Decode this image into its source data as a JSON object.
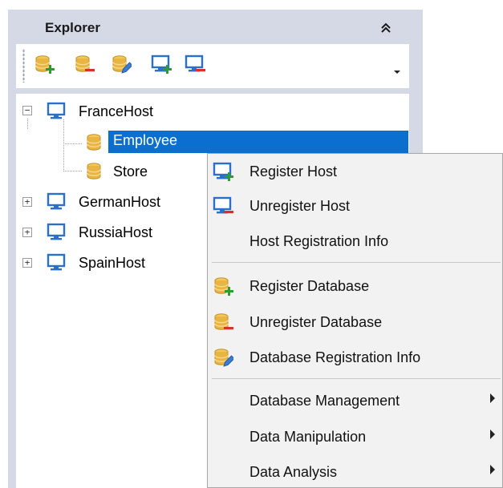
{
  "explorer": {
    "title": "Explorer",
    "collapse_glyph": "»",
    "toolbar": {
      "icons": [
        "register-database-icon",
        "unregister-database-icon",
        "database-info-icon",
        "register-host-icon",
        "unregister-host-icon"
      ],
      "dropdown_glyph": "▾"
    }
  },
  "tree": {
    "hosts": [
      {
        "label": "FranceHost",
        "expanded": true,
        "expander": "−",
        "children": [
          {
            "label": "Employee",
            "selected": true
          },
          {
            "label": "Store",
            "selected": false
          }
        ]
      },
      {
        "label": "GermanHost",
        "expanded": false,
        "expander": "+"
      },
      {
        "label": "RussiaHost",
        "expanded": false,
        "expander": "+"
      },
      {
        "label": "SpainHost",
        "expanded": false,
        "expander": "+"
      }
    ]
  },
  "context_menu": {
    "items": [
      {
        "label": "Register Host",
        "icon": "register-host-icon"
      },
      {
        "label": "Unregister Host",
        "icon": "unregister-host-icon"
      },
      {
        "label": "Host Registration Info",
        "icon": ""
      },
      {
        "label": "Register Database",
        "icon": "register-database-icon"
      },
      {
        "label": "Unregister Database",
        "icon": "unregister-database-icon"
      },
      {
        "label": "Database Registration Info",
        "icon": "database-info-icon"
      },
      {
        "label": "Database Management",
        "submenu": true
      },
      {
        "label": "Data Manipulation",
        "submenu": true
      },
      {
        "label": "Data Analysis",
        "submenu": true
      }
    ]
  },
  "colors": {
    "panel_bg": "#d5d9e6",
    "selection": "#0b6fcf",
    "db_gold": "#e8b543",
    "monitor_blue": "#2a6fc9",
    "plus_green": "#2e9b2e",
    "minus_red": "#d9302c"
  }
}
